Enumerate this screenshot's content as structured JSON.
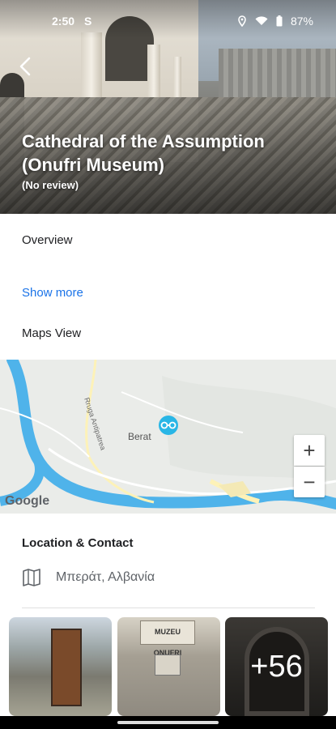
{
  "status": {
    "time": "2:50",
    "notif": "S",
    "battery": "87%"
  },
  "header": {
    "title": "Cathedral of the Assumption (Onufri Museum)",
    "subtitle": "(No review)"
  },
  "sections": {
    "overview": "Overview",
    "show_more": "Show more",
    "maps_view": "Maps View",
    "location_contact": "Location & Contact"
  },
  "map": {
    "city_label": "Berat",
    "road_label": "Rruga Antipatrea",
    "provider": "Google",
    "zoom_in": "+",
    "zoom_out": "−"
  },
  "location": {
    "address": "Μπεράτ, Αλβανία"
  },
  "photos": {
    "sign_text": "MUZEU ONUFRI",
    "more_count": "+56"
  },
  "colors": {
    "link": "#1a73e8",
    "map_pin": "#29b6e6",
    "river": "#4fb3ea"
  }
}
